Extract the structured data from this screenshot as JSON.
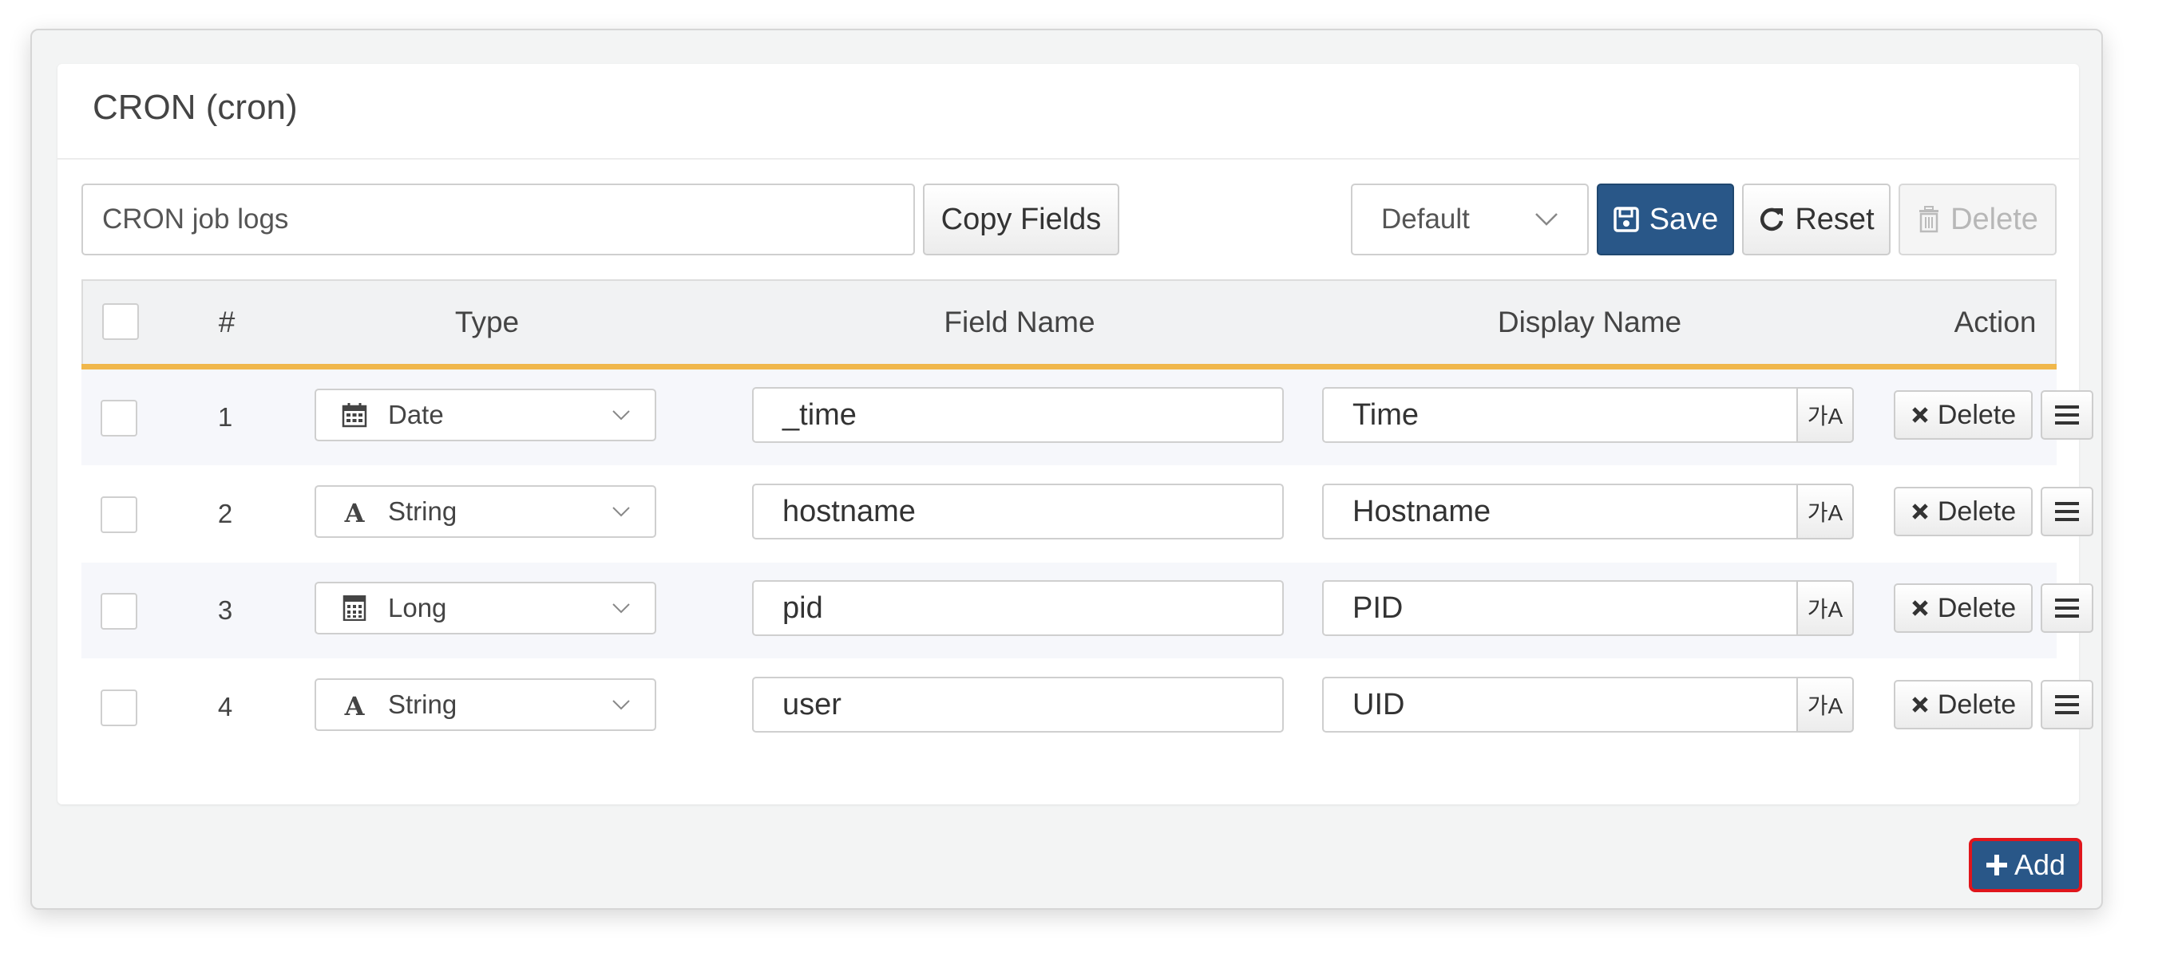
{
  "panel": {
    "title": "CRON (cron)"
  },
  "toolbar": {
    "name_value": "CRON job logs",
    "copy_fields_label": "Copy Fields",
    "view_select_value": "Default",
    "save_label": "Save",
    "reset_label": "Reset",
    "delete_label": "Delete"
  },
  "table": {
    "headers": {
      "num": "#",
      "type": "Type",
      "field_name": "Field Name",
      "display_name": "Display Name",
      "action": "Action"
    },
    "row_delete_label": "Delete",
    "translate_label": "가A",
    "rows": [
      {
        "num": "1",
        "type": "Date",
        "type_icon": "calendar-icon",
        "field_name": "_time",
        "display_name": "Time"
      },
      {
        "num": "2",
        "type": "String",
        "type_icon": "font-icon",
        "field_name": "hostname",
        "display_name": "Hostname"
      },
      {
        "num": "3",
        "type": "Long",
        "type_icon": "calculator-icon",
        "field_name": "pid",
        "display_name": "PID"
      },
      {
        "num": "4",
        "type": "String",
        "type_icon": "font-icon",
        "field_name": "user",
        "display_name": "UID"
      }
    ]
  },
  "footer": {
    "add_label": "Add"
  },
  "colors": {
    "primary": "#295788",
    "header_accent": "#f0b74b",
    "highlight": "#e0161c"
  }
}
